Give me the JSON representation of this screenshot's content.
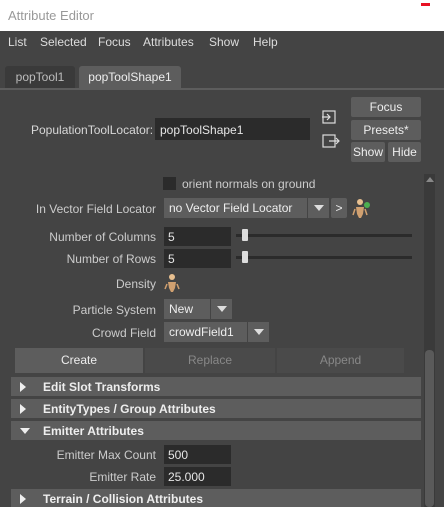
{
  "window": {
    "title": "Attribute Editor",
    "close": "×"
  },
  "menu": [
    "List",
    "Selected",
    "Focus",
    "Attributes",
    "Show",
    "Help"
  ],
  "tabs": [
    "popTool1",
    "popToolShape1"
  ],
  "header": {
    "locator_label": "PopulationToolLocator:",
    "locator_value": "popToolShape1",
    "focus_label": "Focus",
    "presets_label": "Presets*",
    "show_label": "Show",
    "hide_label": "Hide"
  },
  "form": {
    "orient_normals_label": "orient normals on ground",
    "vector_field_label": "In Vector Field Locator",
    "vector_field_value": "no Vector Field Locator",
    "vector_field_nav": ">",
    "columns_label": "Number of Columns",
    "columns_value": "5",
    "rows_label": "Number of Rows",
    "rows_value": "5",
    "density_label": "Density",
    "particle_system_label": "Particle System",
    "particle_system_value": "New",
    "crowd_field_label": "Crowd Field",
    "crowd_field_value": "crowdField1"
  },
  "actions": {
    "create": "Create",
    "replace": "Replace",
    "append": "Append"
  },
  "sections": {
    "edit_slot": "Edit Slot Transforms",
    "entity_types": "EntityTypes / Group Attributes",
    "emitter": "Emitter Attributes",
    "terrain": "Terrain / Collision Attributes"
  },
  "emitter": {
    "max_count_label": "Emitter Max Count",
    "max_count_value": "500",
    "rate_label": "Emitter Rate",
    "rate_value": "25.000"
  },
  "colors": {
    "background": "#444444",
    "field": "#2b2b2b",
    "button": "#5d5d5d",
    "close_accent": "#e81123"
  },
  "icons": [
    "input-connection-icon",
    "output-connection-icon",
    "map-node-icon",
    "density-map-icon",
    "chevron-down-icon",
    "triangle-right-icon",
    "triangle-down-icon"
  ]
}
